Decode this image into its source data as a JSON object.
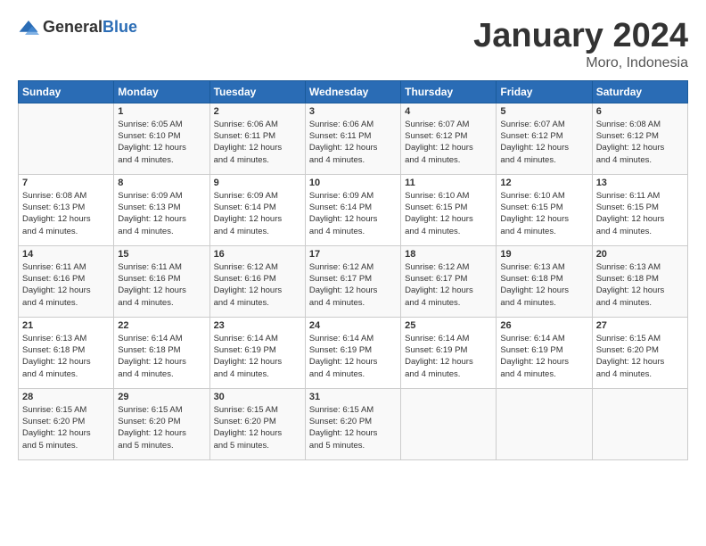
{
  "logo": {
    "general": "General",
    "blue": "Blue"
  },
  "title": "January 2024",
  "location": "Moro, Indonesia",
  "days_header": [
    "Sunday",
    "Monday",
    "Tuesday",
    "Wednesday",
    "Thursday",
    "Friday",
    "Saturday"
  ],
  "weeks": [
    [
      {
        "num": "",
        "info": ""
      },
      {
        "num": "1",
        "info": "Sunrise: 6:05 AM\nSunset: 6:10 PM\nDaylight: 12 hours\nand 4 minutes."
      },
      {
        "num": "2",
        "info": "Sunrise: 6:06 AM\nSunset: 6:11 PM\nDaylight: 12 hours\nand 4 minutes."
      },
      {
        "num": "3",
        "info": "Sunrise: 6:06 AM\nSunset: 6:11 PM\nDaylight: 12 hours\nand 4 minutes."
      },
      {
        "num": "4",
        "info": "Sunrise: 6:07 AM\nSunset: 6:12 PM\nDaylight: 12 hours\nand 4 minutes."
      },
      {
        "num": "5",
        "info": "Sunrise: 6:07 AM\nSunset: 6:12 PM\nDaylight: 12 hours\nand 4 minutes."
      },
      {
        "num": "6",
        "info": "Sunrise: 6:08 AM\nSunset: 6:12 PM\nDaylight: 12 hours\nand 4 minutes."
      }
    ],
    [
      {
        "num": "7",
        "info": "Sunrise: 6:08 AM\nSunset: 6:13 PM\nDaylight: 12 hours\nand 4 minutes."
      },
      {
        "num": "8",
        "info": "Sunrise: 6:09 AM\nSunset: 6:13 PM\nDaylight: 12 hours\nand 4 minutes."
      },
      {
        "num": "9",
        "info": "Sunrise: 6:09 AM\nSunset: 6:14 PM\nDaylight: 12 hours\nand 4 minutes."
      },
      {
        "num": "10",
        "info": "Sunrise: 6:09 AM\nSunset: 6:14 PM\nDaylight: 12 hours\nand 4 minutes."
      },
      {
        "num": "11",
        "info": "Sunrise: 6:10 AM\nSunset: 6:15 PM\nDaylight: 12 hours\nand 4 minutes."
      },
      {
        "num": "12",
        "info": "Sunrise: 6:10 AM\nSunset: 6:15 PM\nDaylight: 12 hours\nand 4 minutes."
      },
      {
        "num": "13",
        "info": "Sunrise: 6:11 AM\nSunset: 6:15 PM\nDaylight: 12 hours\nand 4 minutes."
      }
    ],
    [
      {
        "num": "14",
        "info": "Sunrise: 6:11 AM\nSunset: 6:16 PM\nDaylight: 12 hours\nand 4 minutes."
      },
      {
        "num": "15",
        "info": "Sunrise: 6:11 AM\nSunset: 6:16 PM\nDaylight: 12 hours\nand 4 minutes."
      },
      {
        "num": "16",
        "info": "Sunrise: 6:12 AM\nSunset: 6:16 PM\nDaylight: 12 hours\nand 4 minutes."
      },
      {
        "num": "17",
        "info": "Sunrise: 6:12 AM\nSunset: 6:17 PM\nDaylight: 12 hours\nand 4 minutes."
      },
      {
        "num": "18",
        "info": "Sunrise: 6:12 AM\nSunset: 6:17 PM\nDaylight: 12 hours\nand 4 minutes."
      },
      {
        "num": "19",
        "info": "Sunrise: 6:13 AM\nSunset: 6:18 PM\nDaylight: 12 hours\nand 4 minutes."
      },
      {
        "num": "20",
        "info": "Sunrise: 6:13 AM\nSunset: 6:18 PM\nDaylight: 12 hours\nand 4 minutes."
      }
    ],
    [
      {
        "num": "21",
        "info": "Sunrise: 6:13 AM\nSunset: 6:18 PM\nDaylight: 12 hours\nand 4 minutes."
      },
      {
        "num": "22",
        "info": "Sunrise: 6:14 AM\nSunset: 6:18 PM\nDaylight: 12 hours\nand 4 minutes."
      },
      {
        "num": "23",
        "info": "Sunrise: 6:14 AM\nSunset: 6:19 PM\nDaylight: 12 hours\nand 4 minutes."
      },
      {
        "num": "24",
        "info": "Sunrise: 6:14 AM\nSunset: 6:19 PM\nDaylight: 12 hours\nand 4 minutes."
      },
      {
        "num": "25",
        "info": "Sunrise: 6:14 AM\nSunset: 6:19 PM\nDaylight: 12 hours\nand 4 minutes."
      },
      {
        "num": "26",
        "info": "Sunrise: 6:14 AM\nSunset: 6:19 PM\nDaylight: 12 hours\nand 4 minutes."
      },
      {
        "num": "27",
        "info": "Sunrise: 6:15 AM\nSunset: 6:20 PM\nDaylight: 12 hours\nand 4 minutes."
      }
    ],
    [
      {
        "num": "28",
        "info": "Sunrise: 6:15 AM\nSunset: 6:20 PM\nDaylight: 12 hours\nand 5 minutes."
      },
      {
        "num": "29",
        "info": "Sunrise: 6:15 AM\nSunset: 6:20 PM\nDaylight: 12 hours\nand 5 minutes."
      },
      {
        "num": "30",
        "info": "Sunrise: 6:15 AM\nSunset: 6:20 PM\nDaylight: 12 hours\nand 5 minutes."
      },
      {
        "num": "31",
        "info": "Sunrise: 6:15 AM\nSunset: 6:20 PM\nDaylight: 12 hours\nand 5 minutes."
      },
      {
        "num": "",
        "info": ""
      },
      {
        "num": "",
        "info": ""
      },
      {
        "num": "",
        "info": ""
      }
    ]
  ]
}
